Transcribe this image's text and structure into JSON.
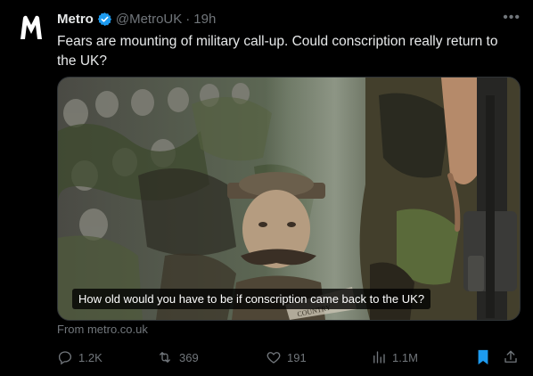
{
  "tweet": {
    "author_name": "Metro",
    "handle": "@MetroUK",
    "separator": "·",
    "time": "19h",
    "text": "Fears are mounting of military call-up. Could conscription really return to the UK?",
    "avatar_letter": "M"
  },
  "media": {
    "caption": "How old would you have to be if conscription came back to the UK?",
    "poster_text": "COUNTRY"
  },
  "link": {
    "from_text": "From metro.co.uk"
  },
  "actions": {
    "replies": "1.2K",
    "reposts": "369",
    "likes": "191",
    "views": "1.1M"
  },
  "colors": {
    "background": "#000000",
    "text": "#e7e9ea",
    "muted": "#71767b",
    "verified": "#1d9bf0",
    "bookmark": "#1d9bf0"
  },
  "icons": [
    "verified-badge-icon",
    "more-icon",
    "reply-icon",
    "repost-icon",
    "like-icon",
    "views-icon",
    "bookmark-icon",
    "share-icon"
  ]
}
